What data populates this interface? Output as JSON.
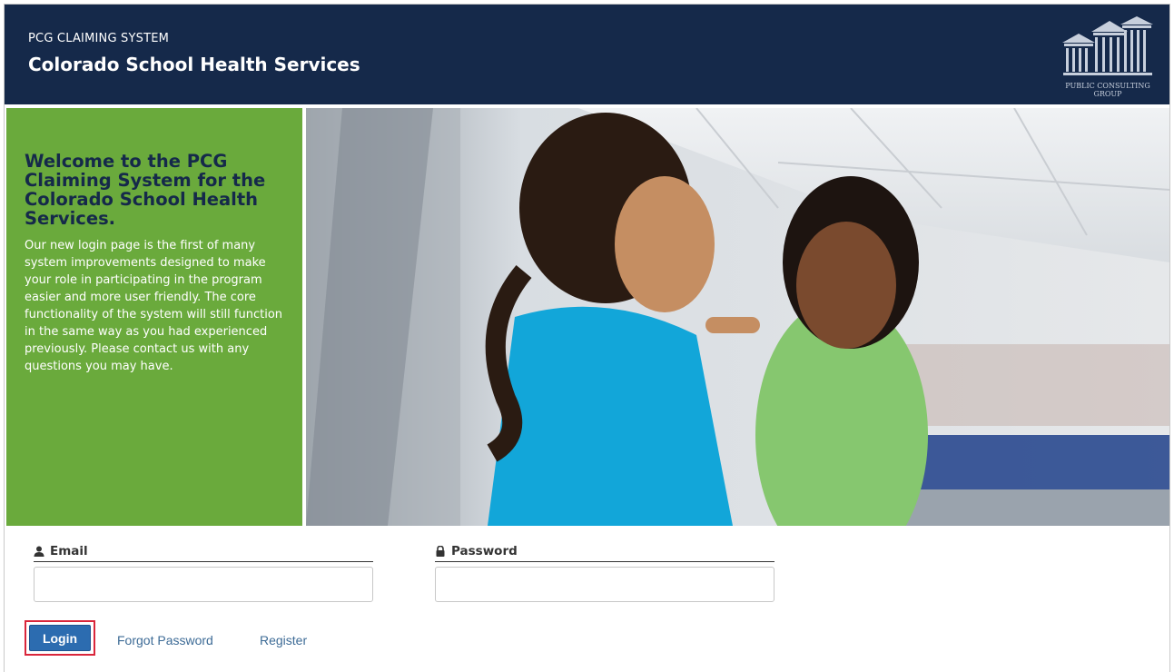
{
  "header": {
    "subtitle": "PCG CLAIMING SYSTEM",
    "title": "Colorado School Health Services",
    "logo_text_line1": "PUBLIC CONSULTING",
    "logo_text_line2": "GROUP",
    "bg_color": "#15294a"
  },
  "welcome": {
    "heading": "Welcome to the PCG Claiming System for the Colorado School Health Services.",
    "body": "Our new login page is the first of many system improvements designed to make your role in participating in the program easier and more user friendly. The core functionality of the system will still function in the same way as you had experienced previously. Please contact us with any questions you may have.",
    "bg_color": "#6aaa3c"
  },
  "hero": {
    "description_icon": "photo"
  },
  "form": {
    "email_label": "Email",
    "email_icon": "user-icon",
    "email_value": "",
    "password_label": "Password",
    "password_icon": "lock-icon",
    "password_value": "",
    "login_label": "Login",
    "forgot_label": "Forgot Password",
    "register_label": "Register",
    "accent_color": "#2c6cb0",
    "highlight_color": "#d9263b"
  }
}
